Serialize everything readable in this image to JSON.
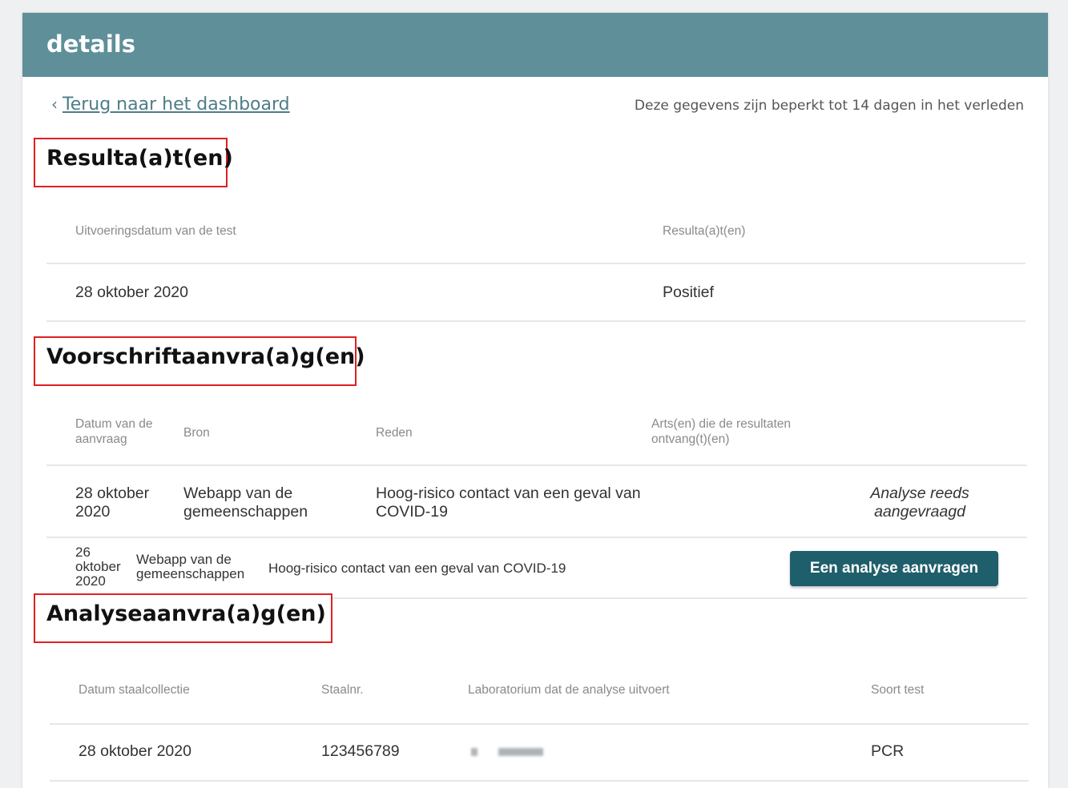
{
  "header": {
    "title": "details"
  },
  "nav": {
    "back_chevron": "‹",
    "back_label": "Terug naar het dashboard"
  },
  "note": "Deze gegevens zijn beperkt tot 14 dagen in het verleden",
  "results": {
    "title": "Resulta(a)t(en)",
    "columns": [
      "Uitvoeringsdatum van de test",
      "Resulta(a)t(en)"
    ],
    "rows": [
      {
        "date": "28 oktober 2020",
        "result": "Positief"
      }
    ]
  },
  "prescriptions": {
    "title": "Voorschriftaanvra(a)g(en)",
    "columns": [
      "Datum van de aanvraag",
      "Bron",
      "Reden",
      "Arts(en) die de resultaten ontvang(t)(en)"
    ],
    "rows": [
      {
        "date": "28 oktober 2020",
        "source": "Webapp van de gemeenschappen",
        "reason": "Hoog-risico contact van een geval van COVID-19",
        "doctors": "",
        "status": "Analyse reeds aangevraagd"
      },
      {
        "date": "26 oktober 2020",
        "source": "Webapp van de gemeenschappen",
        "reason": "Hoog-risico contact van een geval van COVID-19",
        "doctors": "",
        "action_label": "Een analyse aanvragen"
      }
    ]
  },
  "analyses": {
    "title": "Analyseaanvra(a)g(en)",
    "columns": [
      "Datum staalcollectie",
      "Staalnr.",
      "Laboratorium dat de analyse uitvoert",
      "Soort test"
    ],
    "rows": [
      {
        "date": "28 oktober 2020",
        "sample_no": "123456789",
        "lab": "",
        "test_type": "PCR"
      }
    ]
  },
  "icons": {
    "back": "chevron-left-icon"
  },
  "colors": {
    "header_bg": "#5f8f99",
    "link": "#4e7d87",
    "button_bg": "#1f5e6b",
    "highlight_border": "#e02020"
  }
}
